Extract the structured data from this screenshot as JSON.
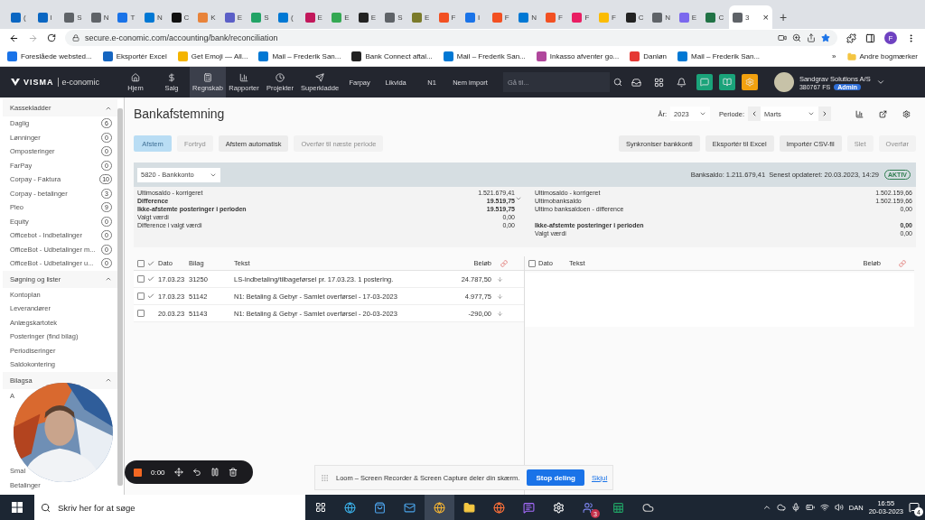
{
  "browser": {
    "tabs": [
      {
        "label": "(",
        "color": "#0a66c2",
        "selected": false
      },
      {
        "label": "l",
        "color": "#0a66c2",
        "selected": false
      },
      {
        "label": "S",
        "color": "#5f6368",
        "selected": false
      },
      {
        "label": "N",
        "color": "#5f6368",
        "selected": false
      },
      {
        "label": "T",
        "color": "#1a73e8",
        "selected": false
      },
      {
        "label": "N",
        "color": "#0078d4",
        "selected": false
      },
      {
        "label": "C",
        "color": "#111111",
        "selected": false
      },
      {
        "label": "K",
        "color": "#e8833a",
        "selected": false
      },
      {
        "label": "E",
        "color": "#5b5fc7",
        "selected": false
      },
      {
        "label": "S",
        "color": "#21a366",
        "selected": false
      },
      {
        "label": "(",
        "color": "#0078d4",
        "selected": false
      },
      {
        "label": "E",
        "color": "#c2185b",
        "selected": false
      },
      {
        "label": "E",
        "color": "#34a853",
        "selected": false
      },
      {
        "label": "E",
        "color": "#222222",
        "selected": false
      },
      {
        "label": "S",
        "color": "#5f6368",
        "selected": false
      },
      {
        "label": "E",
        "color": "#7a7a2a",
        "selected": false
      },
      {
        "label": "F",
        "color": "#f25022",
        "selected": false
      },
      {
        "label": "I",
        "color": "#1a73e8",
        "selected": false
      },
      {
        "label": "F",
        "color": "#f25022",
        "selected": false
      },
      {
        "label": "N",
        "color": "#0078d4",
        "selected": false
      },
      {
        "label": "F",
        "color": "#f25022",
        "selected": false
      },
      {
        "label": "F",
        "color": "#e91e63",
        "selected": false
      },
      {
        "label": "F",
        "color": "#fbbc04",
        "selected": false
      },
      {
        "label": "C",
        "color": "#222222",
        "selected": false
      },
      {
        "label": "N",
        "color": "#5f6368",
        "selected": false
      },
      {
        "label": "E",
        "color": "#7b68ee",
        "selected": false
      },
      {
        "label": "C",
        "color": "#217346",
        "selected": false
      },
      {
        "label": "3",
        "color": "#5f6368",
        "selected": true
      }
    ],
    "close": "×",
    "new_tab": "+",
    "address": "secure.e-conomic.com/accounting/bank/reconciliation",
    "profile": "F",
    "bookmarks": [
      {
        "label": "Foreslåede websted...",
        "color": "#1a73e8"
      },
      {
        "label": "Eksportér Excel",
        "color": "#1565c0"
      },
      {
        "label": "Get Emoji — All...",
        "color": "#f4b400"
      },
      {
        "label": "Mail – Frederik San...",
        "color": "#0078d4"
      },
      {
        "label": "Bank Connect aftal...",
        "color": "#222222"
      },
      {
        "label": "Mail – Frederik San...",
        "color": "#0078d4"
      },
      {
        "label": "Inkasso afventer go...",
        "color": "#b0479c"
      },
      {
        "label": "Danløn",
        "color": "#e53935"
      },
      {
        "label": "Mail – Frederik San...",
        "color": "#0078d4"
      }
    ],
    "more": "»",
    "other_bookmarks": "Andre bogmærker"
  },
  "nav": {
    "logo": "VISMA",
    "product": "e-conomic",
    "items": [
      {
        "label": "Hjem",
        "selected": false
      },
      {
        "label": "Salg",
        "selected": false
      },
      {
        "label": "Regnskab",
        "selected": true
      },
      {
        "label": "Rapporter",
        "selected": false
      },
      {
        "label": "Projekter",
        "selected": false
      },
      {
        "label": "Superkladde",
        "selected": false
      },
      {
        "label": "Farpay",
        "selected": false
      },
      {
        "label": "Likvida",
        "selected": false
      },
      {
        "label": "N1",
        "selected": false
      },
      {
        "label": "Nem import",
        "selected": false
      }
    ],
    "search": {
      "placeholder": "Gå til..."
    },
    "company": "Sandgrav Solutions A/S",
    "account": "380767 FS",
    "role": "Admin"
  },
  "sidebar": {
    "sections": [
      {
        "title": "Kassekladder",
        "expanded": true,
        "items": [
          {
            "label": "Daglig",
            "count": "6"
          },
          {
            "label": "Lønninger",
            "count": "0"
          },
          {
            "label": "Omposteringer",
            "count": "0"
          },
          {
            "label": "FarPay",
            "count": "0"
          },
          {
            "label": "Corpay - Faktura",
            "count": "10"
          },
          {
            "label": "Corpay - betalinger",
            "count": "3"
          },
          {
            "label": "Pleo",
            "count": "9"
          },
          {
            "label": "Equity",
            "count": "0"
          },
          {
            "label": "Officebot - Indbetalinger",
            "count": "0"
          },
          {
            "label": "OfficeBot - Udbetalinger m...",
            "count": "0"
          },
          {
            "label": "OfficeBot - Udbetalinger u...",
            "count": "0"
          }
        ]
      },
      {
        "title": "Søgning og lister",
        "expanded": true,
        "items": [
          {
            "label": "Kontoplan"
          },
          {
            "label": "Leverandører"
          },
          {
            "label": "Anlægskartotek"
          },
          {
            "label": "Posteringer (find bilag)"
          },
          {
            "label": "Periodiseringer"
          },
          {
            "label": "Saldokontering"
          }
        ]
      },
      {
        "title": "Bilagsa",
        "expanded": true,
        "items": [
          {
            "label": "A"
          },
          {
            "label": "Smal"
          },
          {
            "label": "Betalinger"
          }
        ]
      }
    ]
  },
  "page": {
    "title": "Bankafstemning",
    "year": {
      "label": "År:",
      "value": "2023"
    },
    "period": {
      "label": "Periode:",
      "value": "Marts"
    },
    "actions": [
      {
        "label": "Afstem",
        "kind": "primary",
        "disabled": true
      },
      {
        "label": "Fortryd",
        "kind": "default",
        "disabled": true
      },
      {
        "label": "Afstem automatisk",
        "kind": "default",
        "disabled": false
      },
      {
        "label": "Overfør til næste periode",
        "kind": "default",
        "disabled": true
      }
    ],
    "tools": [
      {
        "label": "Synkroniser bankkonti",
        "disabled": false
      },
      {
        "label": "Eksportér til Excel",
        "disabled": false
      },
      {
        "label": "Importér CSV-fil",
        "disabled": false
      },
      {
        "label": "Slet",
        "disabled": true
      },
      {
        "label": "Overfør",
        "disabled": true
      }
    ],
    "account": {
      "value": "5820 - Bankkonto",
      "balance": "Banksaldo: 1.211.679,41  Senest opdateret: 20.03.2023, 14:29",
      "status": "AKTIV"
    },
    "summary_left": [
      {
        "label": "Ultimosaldo - korrigeret",
        "value": "1.521.679,41",
        "bold": false
      },
      {
        "label": "Difference",
        "value": "19.519,75",
        "bold": true
      },
      {
        "label": "Ikke-afstemte posteringer i perioden",
        "value": "19.519,75",
        "bold": true
      },
      {
        "label": "Valgt værdi",
        "value": "0,00",
        "bold": false
      },
      {
        "label": "Difference i valgt værdi",
        "value": "0,00",
        "bold": false
      }
    ],
    "summary_right": [
      {
        "rows": [
          {
            "label": "Ultimosaldo - korrigeret",
            "value": "1.502.159,66",
            "bold": false
          },
          {
            "label": "Ultimobanksaldo",
            "value": "1.502.159,66",
            "bold": false
          },
          {
            "label": "Ultimo banksaldoen - difference",
            "value": "0,00",
            "bold": false
          }
        ]
      },
      {
        "rows": [
          {
            "label": "Ikke-afstemte posteringer i perioden",
            "value": "0,00",
            "bold": true
          },
          {
            "label": "Valgt værdi",
            "value": "0,00",
            "bold": false
          }
        ]
      }
    ],
    "ledger": {
      "columns": [
        "Dato",
        "Bilag",
        "Tekst",
        "Beløb"
      ],
      "all_checked": false,
      "rows": [
        {
          "date": "17.03.23",
          "voucher": "31250",
          "text": "LS-Indbetaling/tilbageførsel pr. 17.03.23. 1 postering.",
          "amount": "24.787,50",
          "checked": false,
          "matched": true
        },
        {
          "date": "17.03.23",
          "voucher": "51142",
          "text": "N1: Betaling & Gebyr - Samlet overførsel - 17-03-2023",
          "amount": "4.977,75",
          "checked": false,
          "matched": true
        },
        {
          "date": "20.03.23",
          "voucher": "51143",
          "text": "N1: Betaling & Gebyr - Samlet overførsel - 20-03-2023",
          "amount": "-290,00",
          "checked": false,
          "matched": false
        }
      ]
    },
    "bank": {
      "columns": [
        "Dato",
        "Tekst",
        "Beløb"
      ],
      "all_checked": false
    }
  },
  "recorder": {
    "time": "0:00"
  },
  "sharing": {
    "message": "Loom – Screen Recorder & Screen Capture deler din skærm.",
    "stop": "Stop deling",
    "hide": "Skjul"
  },
  "taskbar": {
    "search": {
      "placeholder": "Skriv her for at søge"
    },
    "teams_badge": "3",
    "language": "DAN",
    "time": "16:55",
    "date": "20-03-2023",
    "notifications": "4"
  }
}
